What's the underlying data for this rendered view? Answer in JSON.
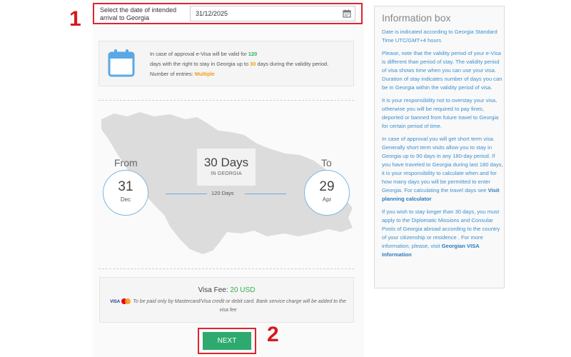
{
  "annotations": {
    "step1": "1",
    "step2": "2"
  },
  "date_field": {
    "label": "Select the date of intended arrival to Georgia",
    "value": "31/12/2025"
  },
  "validity": {
    "text_a": "In case of approval e-Visa will be valid for ",
    "valid_days": "120",
    "text_b": "days with the right to stay in Georgia up to ",
    "stay_days": "30",
    "text_c": " days during the validity period.",
    "entries_label": "Number of entries: ",
    "entries_value": "Multiple"
  },
  "trip": {
    "from_label": "From",
    "from_day": "31",
    "from_month": "Dec",
    "to_label": "To",
    "to_day": "29",
    "to_month": "Apr",
    "days_title": "30 Days",
    "days_subtitle": "IN GEORGIA",
    "validity_days": "120 Days"
  },
  "fee": {
    "label": "Visa Fee: ",
    "amount": "20 USD",
    "visa_logo": "VISA",
    "note": "To be paid only by Mastercard/Visa credit or debit card. Bank service charge will be added to the visa fee"
  },
  "next_button": "NEXT",
  "info_box": {
    "title": "Information box",
    "p1": "Date is indicated according to Georgia Standard Time UTC/GMT+4 hours",
    "p2": "Please, note that the validity period of your e-Visa is different than period of stay. The validity period of visa shows time when you can use your visa. Duration of stay indicates number of days you can be in Georgia within the validity period of visa.",
    "p3": "It is your responsibility not to overstay your visa, otherwise you will be required to pay fines, deported or banned from future travel to Georgia for certain period of time.",
    "p4": "In case of approval you will get short term visa. Generally short term visits allow you to stay in Georgia up to 90 days in any 180-day period. If you have traveled to Georgia during last 180 days, it is your responsibility to calculate when and for how many days you will be permitted to enter Georgia. For calculating the travel days see ",
    "p4_link": "Visit planning calculator",
    "p5": "If you wish to stay longer than 30 days, you must apply to the Diplomatic Missions and Consular Posts of Georgia abroad according to the country of your citizenship or residence . For more information, please, visit ",
    "p5_link": "Georgian VISA Information"
  },
  "colors": {
    "accent_green": "#2db34a",
    "accent_orange": "#f39c12",
    "link_blue": "#3b8fcf",
    "button_green": "#2eaa6e",
    "annotation_red": "#e0242d"
  }
}
